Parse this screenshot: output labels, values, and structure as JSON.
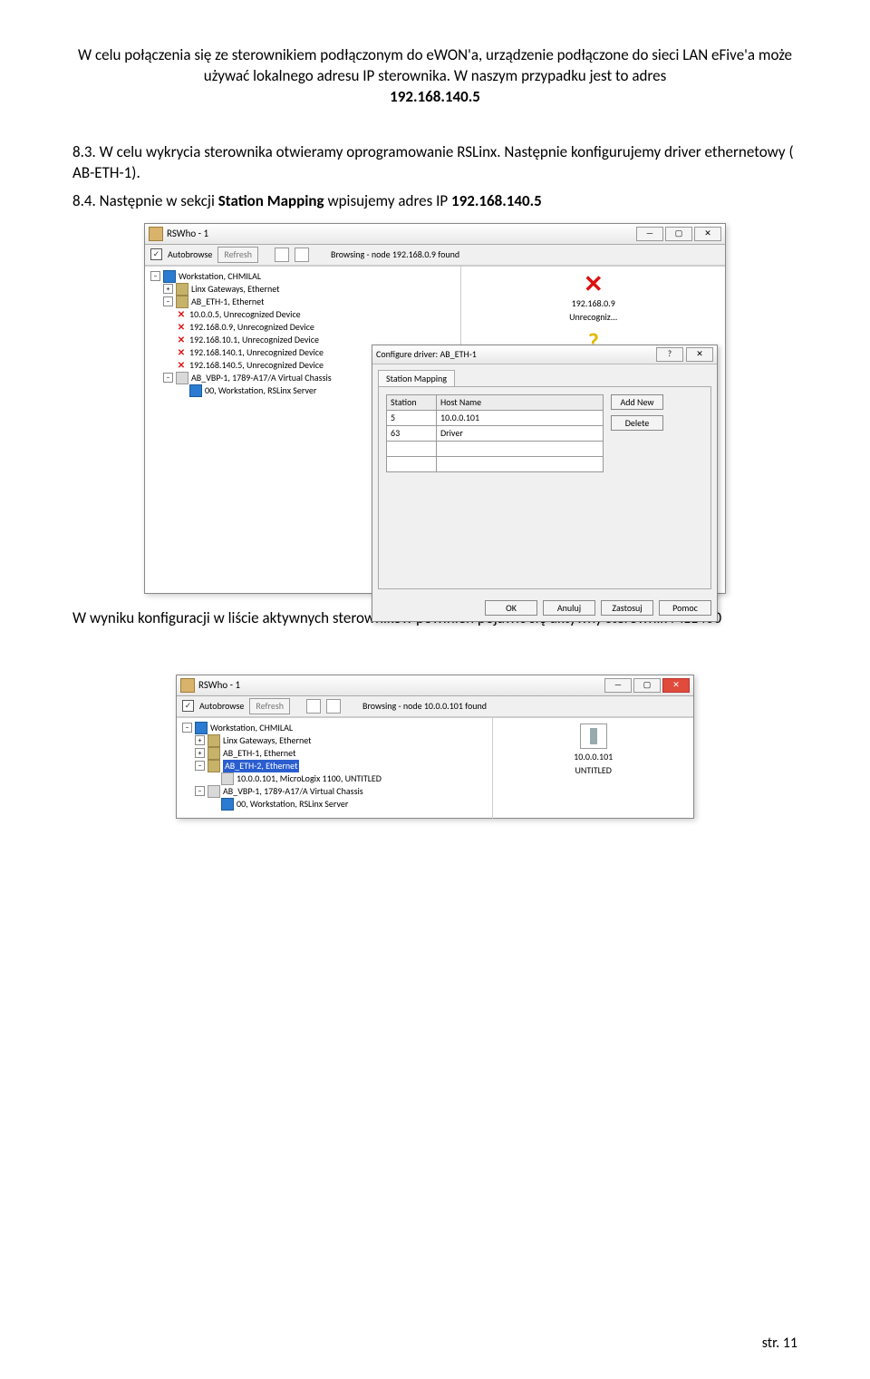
{
  "para1": "W celu połączenia się ze sterownikiem podłączonym do eWON'a, urządzenie podłączone do sieci LAN eFive'a może używać lokalnego adresu IP sterownika. W naszym przypadku jest to adres",
  "ipAddr": "192.168.140.5",
  "para2a": "8.3. W celu wykrycia sterownika otwieramy oprogramowanie RSLinx. Następnie konfigurujemy driver ethernetowy ( AB-ETH-1).",
  "para3_prefix": "8.4. Następnie w sekcji ",
  "para3_bold": "Station Mapping",
  "para3_suffix": " wpisujemy adres IP ",
  "para3_ip": "192.168.140.5",
  "para4": "W wyniku konfiguracji w liście aktywnych sterowników powinien pojawić się aktywny sterownik ML1400",
  "footer": "str. 11",
  "rswho1": {
    "title": "RSWho - 1",
    "autobrowse": "Autobrowse",
    "refresh": "Refresh",
    "browsing": "Browsing - node 192.168.0.9 found",
    "tree": {
      "root": "Workstation, CHMILAL",
      "linx": "Linx Gateways, Ethernet",
      "abeth": "AB_ETH-1, Ethernet",
      "d1": "10.0.0.5, Unrecognized Device",
      "d2": "192.168.0.9, Unrecognized Device",
      "d3": "192.168.10.1, Unrecognized Device",
      "d4": "192.168.140.1, Unrecognized Device",
      "d5": "192.168.140.5, Unrecognized Device",
      "abvbp": "AB_VBP-1, 1789-A17/A Virtual Chassis",
      "ws00": "00, Workstation, RSLinx Server"
    },
    "right": {
      "ip": "192.168.0.9",
      "label": "Unrecogniz..."
    },
    "dialog": {
      "title": "Configure driver: AB_ETH-1",
      "tab": "Station Mapping",
      "col1": "Station",
      "col2": "Host Name",
      "r1c1": "5",
      "r1c2": "10.0.0.101",
      "r2c1": "63",
      "r2c2": "Driver",
      "addnew": "Add New",
      "delete": "Delete",
      "ok": "OK",
      "anuluj": "Anuluj",
      "zastosuj": "Zastosuj",
      "pomoc": "Pomoc"
    }
  },
  "rswho2": {
    "title": "RSWho - 1",
    "autobrowse": "Autobrowse",
    "refresh": "Refresh",
    "browsing": "Browsing - node 10.0.0.101 found",
    "tree": {
      "root": "Workstation, CHMILAL",
      "linx": "Linx Gateways, Ethernet",
      "abeth1": "AB_ETH-1, Ethernet",
      "abeth2": "AB_ETH-2, Ethernet",
      "device": "10.0.0.101, MicroLogix 1100, UNTITLED",
      "abvbp": "AB_VBP-1, 1789-A17/A Virtual Chassis",
      "ws00": "00, Workstation, RSLinx Server"
    },
    "right": {
      "ip": "10.0.0.101",
      "label": "UNTITLED"
    }
  }
}
